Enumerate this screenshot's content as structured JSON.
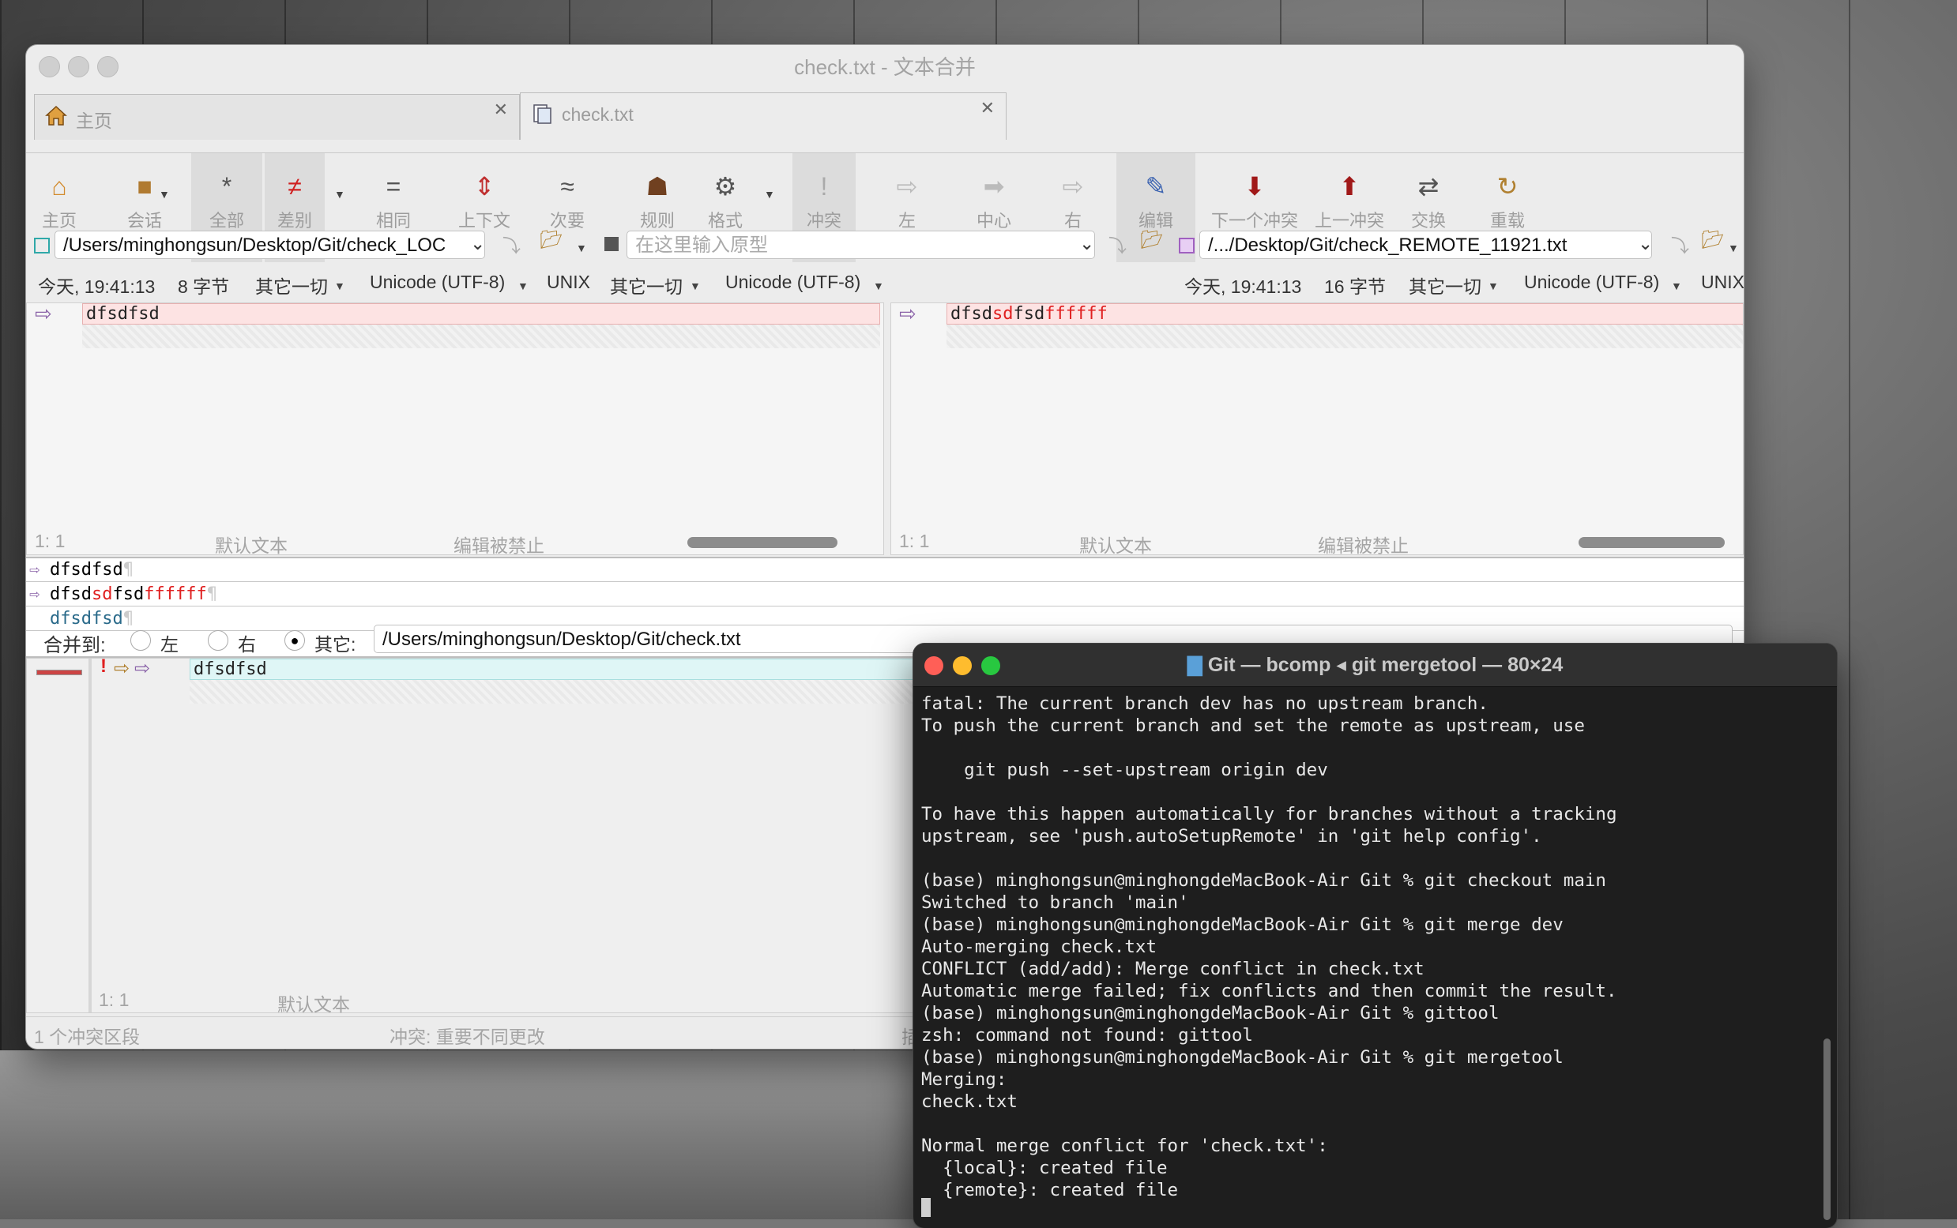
{
  "window_title": "check.txt - 文本合并",
  "tabs": [
    {
      "label": "主页"
    },
    {
      "label": "check.txt"
    }
  ],
  "toolbar": [
    "主页",
    "会话",
    "全部",
    "差别",
    "相同",
    "上下文",
    "次要",
    "规则",
    "格式",
    "冲突",
    "左",
    "中心",
    "右",
    "编辑",
    "下一个冲突",
    "上一冲突",
    "交换",
    "重载"
  ],
  "left": {
    "path": "/Users/minghongsun/Desktop/Git/check_LOC",
    "date": "今天, 19:41:13",
    "size": "8 字节",
    "filter": "其它一切",
    "encoding": "Unicode (UTF-8)",
    "eol": "UNIX",
    "text": "dfsdfsd",
    "pos": "1: 1",
    "mode": "默认文本",
    "edit": "编辑被禁止"
  },
  "base": {
    "placeholder": "在这里输入原型",
    "filter": "其它一切",
    "encoding": "Unicode (UTF-8)"
  },
  "right": {
    "path": "/.../Desktop/Git/check_REMOTE_11921.txt",
    "date": "今天, 19:41:13",
    "size": "16 字节",
    "filter": "其它一切",
    "encoding": "Unicode (UTF-8)",
    "eol": "UNIX",
    "text_a": "dfsd",
    "text_b": "sd",
    "text_c": "fsd",
    "text_d": "ffffff",
    "pos": "1: 1",
    "mode": "默认文本",
    "edit": "编辑被禁止"
  },
  "compare": {
    "l1": "dfsdfsd",
    "l2a": "dfsd",
    "l2b": "sd",
    "l2c": "fsd",
    "l2d": "ffffff",
    "l3": "dfsdfsd",
    "pilcrow": "¶"
  },
  "merge": {
    "label": "合并到:",
    "opt_left": "左",
    "opt_right": "右",
    "opt_other": "其它:",
    "path": "/Users/minghongsun/Desktop/Git/check.txt",
    "text": "dfsdfsd",
    "pos": "1: 1",
    "mode": "默认文本"
  },
  "statusbar": {
    "conflicts": "1 个冲突区段",
    "conflict_desc": "冲突: 重要不同更改",
    "trail": "插"
  },
  "terminal": {
    "title": "Git — bcomp ◂ git mergetool — 80×24",
    "lines": [
      "fatal: The current branch dev has no upstream branch.",
      "To push the current branch and set the remote as upstream, use",
      "",
      "    git push --set-upstream origin dev",
      "",
      "To have this happen automatically for branches without a tracking",
      "upstream, see 'push.autoSetupRemote' in 'git help config'.",
      "",
      "(base) minghongsun@minghongdeMacBook-Air Git % git checkout main",
      "Switched to branch 'main'",
      "(base) minghongsun@minghongdeMacBook-Air Git % git merge dev",
      "Auto-merging check.txt",
      "CONFLICT (add/add): Merge conflict in check.txt",
      "Automatic merge failed; fix conflicts and then commit the result.",
      "(base) minghongsun@minghongdeMacBook-Air Git % gittool",
      "zsh: command not found: gittool",
      "(base) minghongsun@minghongdeMacBook-Air Git % git mergetool",
      "Merging:",
      "check.txt",
      "",
      "Normal merge conflict for 'check.txt':",
      "  {local}: created file",
      "  {remote}: created file"
    ]
  }
}
